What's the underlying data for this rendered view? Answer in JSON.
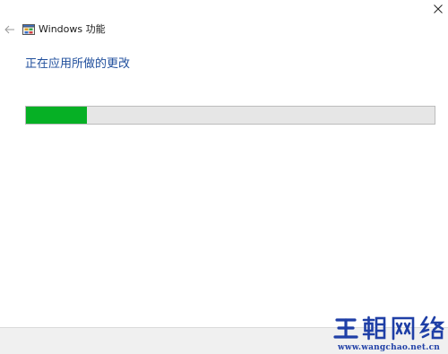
{
  "window": {
    "title": "Windows 功能",
    "close_icon": "close-icon",
    "back_icon": "back-arrow-icon",
    "app_icon": "windows-features-icon"
  },
  "main": {
    "heading": "正在应用所做的更改",
    "progress": {
      "value_percent": 15,
      "fill_color": "#06b025",
      "track_color": "#e6e6e6"
    }
  },
  "colors": {
    "heading": "#1f4e9c",
    "watermark": "#1f3fa6"
  },
  "watermark": {
    "logo_text": "王朝网络",
    "url": "www.wangchao.net.cn"
  }
}
